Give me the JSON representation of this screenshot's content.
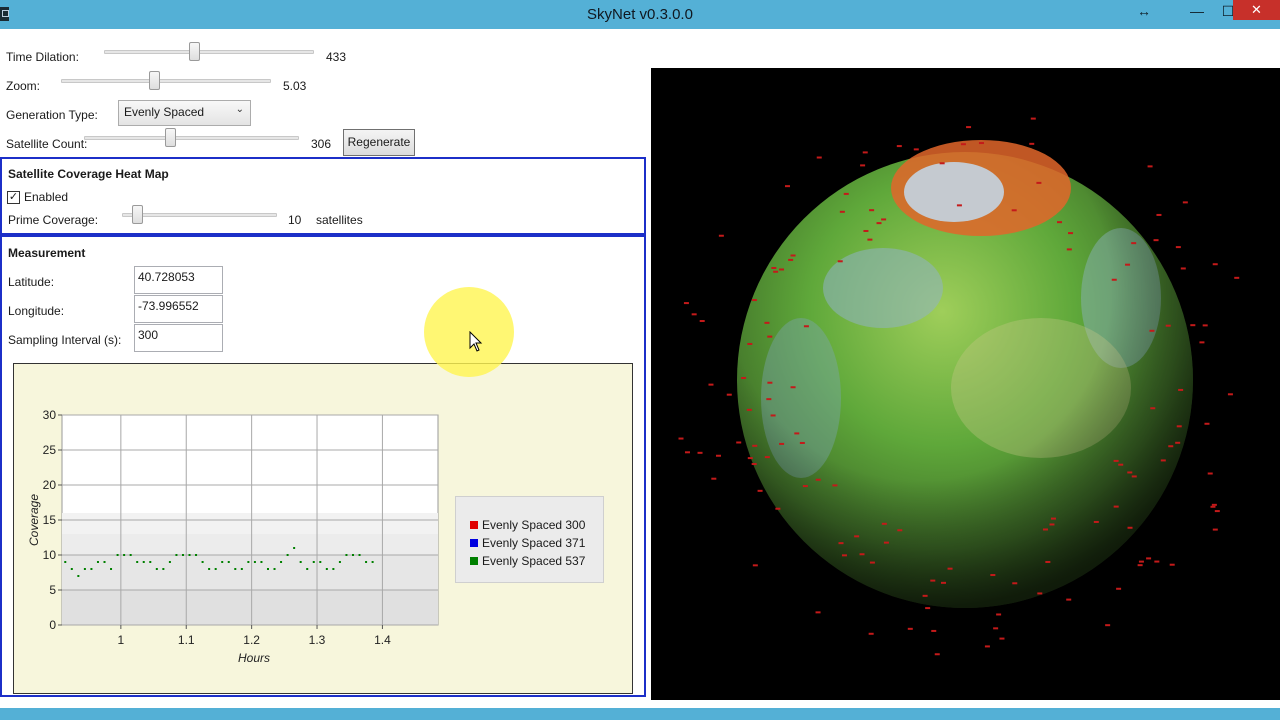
{
  "window": {
    "title": "SkyNet v0.3.0.0",
    "controls": {
      "restore": "↔",
      "minimize": "—",
      "maximize": "☐",
      "close": "✕"
    }
  },
  "settings": {
    "time_dilation": {
      "label": "Time Dilation:",
      "value": "433",
      "level": 0.55
    },
    "zoom": {
      "label": "Zoom:",
      "value": "5.03",
      "level": 0.45
    },
    "generation_type": {
      "label": "Generation Type:",
      "selected": "Evenly Spaced"
    },
    "satellite_count": {
      "label": "Satellite Count:",
      "value": "306",
      "level": 0.47
    },
    "regenerate_label": "Regenerate"
  },
  "heatmap": {
    "title": "Satellite Coverage Heat Map",
    "enabled_label": "Enabled",
    "enabled": true,
    "prime_coverage": {
      "label": "Prime Coverage:",
      "value": "10",
      "unit": "satellites",
      "level": 0.06
    }
  },
  "measurement": {
    "title": "Measurement",
    "latitude": {
      "label": "Latitude:",
      "value": "40.728053"
    },
    "longitude": {
      "label": "Longitude:",
      "value": "-73.996552"
    },
    "sampling_interval": {
      "label": "Sampling Interval (s):",
      "value": "300"
    }
  },
  "chart_data": {
    "type": "scatter",
    "title": "",
    "xlabel": "Hours",
    "ylabel": "Coverage",
    "xlim": [
      0.91,
      1.485
    ],
    "ylim": [
      0,
      30
    ],
    "xticks": [
      1,
      1.1,
      1.2,
      1.3,
      1.4
    ],
    "xtick_labels": [
      "1",
      "1.1",
      "1.2",
      "1.3",
      "1.4"
    ],
    "yticks": [
      0,
      5,
      10,
      15,
      20,
      25,
      30
    ],
    "grid": true,
    "legend_position": "right",
    "series": [
      {
        "name": "Evenly Spaced 300",
        "color": "#e00000",
        "points": []
      },
      {
        "name": "Evenly Spaced 371",
        "color": "#0000e0",
        "points": []
      },
      {
        "name": "Evenly Spaced 537",
        "color": "#008000",
        "points": [
          [
            0.915,
            9
          ],
          [
            0.925,
            8
          ],
          [
            0.935,
            7
          ],
          [
            0.945,
            8
          ],
          [
            0.955,
            8
          ],
          [
            0.965,
            9
          ],
          [
            0.975,
            9
          ],
          [
            0.985,
            8
          ],
          [
            0.995,
            10
          ],
          [
            1.005,
            10
          ],
          [
            1.015,
            10
          ],
          [
            1.025,
            9
          ],
          [
            1.035,
            9
          ],
          [
            1.045,
            9
          ],
          [
            1.055,
            8
          ],
          [
            1.065,
            8
          ],
          [
            1.075,
            9
          ],
          [
            1.085,
            10
          ],
          [
            1.095,
            10
          ],
          [
            1.105,
            10
          ],
          [
            1.115,
            10
          ],
          [
            1.125,
            9
          ],
          [
            1.135,
            8
          ],
          [
            1.145,
            8
          ],
          [
            1.155,
            9
          ],
          [
            1.165,
            9
          ],
          [
            1.175,
            8
          ],
          [
            1.185,
            8
          ],
          [
            1.195,
            9
          ],
          [
            1.205,
            9
          ],
          [
            1.215,
            9
          ],
          [
            1.225,
            8
          ],
          [
            1.235,
            8
          ],
          [
            1.245,
            9
          ],
          [
            1.255,
            10
          ],
          [
            1.265,
            11
          ],
          [
            1.275,
            9
          ],
          [
            1.285,
            8
          ],
          [
            1.295,
            9
          ],
          [
            1.305,
            9
          ],
          [
            1.315,
            8
          ],
          [
            1.325,
            8
          ],
          [
            1.335,
            9
          ],
          [
            1.345,
            10
          ],
          [
            1.355,
            10
          ],
          [
            1.365,
            10
          ],
          [
            1.375,
            9
          ],
          [
            1.385,
            9
          ]
        ]
      }
    ]
  },
  "icons": {
    "restore": "resize-icon",
    "checkbox": "checkmark-icon",
    "pointer": "mouse-cursor-icon"
  },
  "colors": {
    "titlebar": "#54b0d6",
    "group_border": "#1c2fc8",
    "chart_background": "#f7f6dc",
    "close": "#c7302a"
  }
}
